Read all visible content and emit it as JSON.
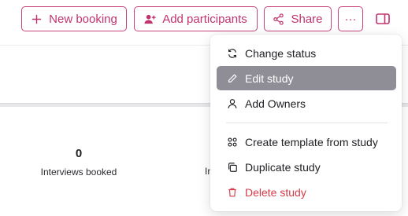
{
  "toolbar": {
    "new_booking_label": "New booking",
    "add_participants_label": "Add participants",
    "share_label": "Share",
    "more_label": "···"
  },
  "stats": [
    {
      "value": "0",
      "label": "Interviews booked"
    },
    {
      "partial_label": "In"
    }
  ],
  "menu": {
    "items": [
      {
        "label": "Change status",
        "icon": "refresh-icon"
      },
      {
        "label": "Edit study",
        "icon": "pencil-icon"
      },
      {
        "label": "Add Owners",
        "icon": "person-icon"
      },
      {
        "label": "Create template from study",
        "icon": "template-icon"
      },
      {
        "label": "Duplicate study",
        "icon": "duplicate-icon"
      },
      {
        "label": "Delete study",
        "icon": "trash-icon"
      }
    ]
  },
  "colors": {
    "accent": "#c0336e",
    "active_item_bg": "#8f8e96",
    "danger": "#d43a47"
  }
}
